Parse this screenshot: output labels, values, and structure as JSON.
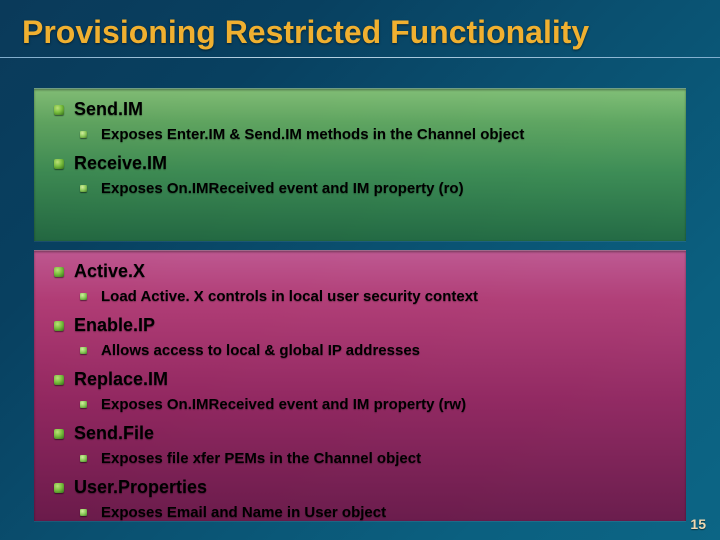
{
  "title": "Provisioning Restricted Functionality",
  "page_number": "15",
  "panel_green": {
    "items": [
      {
        "label": "Send.IM",
        "desc": "Exposes Enter.IM & Send.IM methods in the Channel object"
      },
      {
        "label": "Receive.IM",
        "desc": "Exposes On.IMReceived event and IM property (ro)"
      }
    ]
  },
  "panel_pink": {
    "items": [
      {
        "label": "Active.X",
        "desc": "Load Active. X controls in local user security context"
      },
      {
        "label": "Enable.IP",
        "desc": "Allows access to local & global IP addresses"
      },
      {
        "label": "Replace.IM",
        "desc": "Exposes On.IMReceived event and IM property (rw)"
      },
      {
        "label": "Send.File",
        "desc": "Exposes file xfer PEMs in the Channel object"
      },
      {
        "label": "User.Properties",
        "desc": "Exposes Email and Name in User object"
      }
    ]
  }
}
